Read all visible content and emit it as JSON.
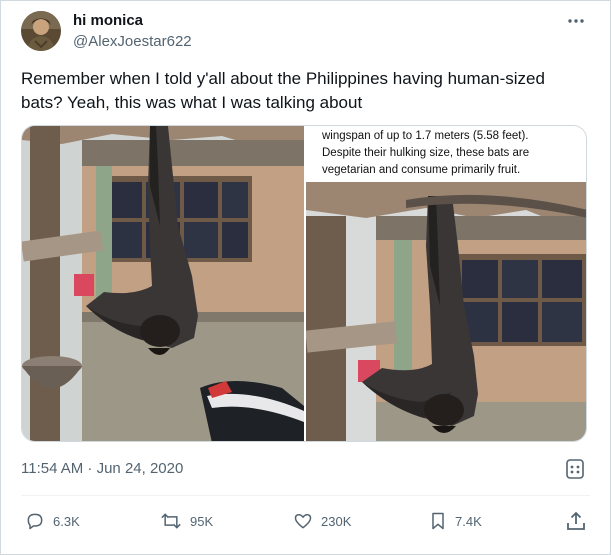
{
  "author": {
    "display_name": "hi monica",
    "handle": "@AlexJoestar622",
    "avatar_icon": "avatar-photo"
  },
  "tweet": {
    "text": "Remember when I told y'all about the Philippines having human-sized bats? Yeah, this was what I was talking about",
    "timestamp": "11:54 AM · Jun 24, 2020"
  },
  "media": {
    "right_caption_lines": [
      "wingspan of up to 1.7 meters (5.58 feet).",
      "Despite their hulking size, these bats are",
      "vegetarian and consume primarily fruit."
    ]
  },
  "actions": {
    "replies": "6.3K",
    "reposts": "95K",
    "likes": "230K",
    "bookmarks": "7.4K"
  },
  "icons": [
    "more-icon",
    "views-icon",
    "reply-icon",
    "repost-icon",
    "like-icon",
    "bookmark-icon",
    "share-icon"
  ],
  "colors": {
    "text": "#0f1419",
    "secondary_text": "#536471",
    "border": "#cfd9de"
  }
}
